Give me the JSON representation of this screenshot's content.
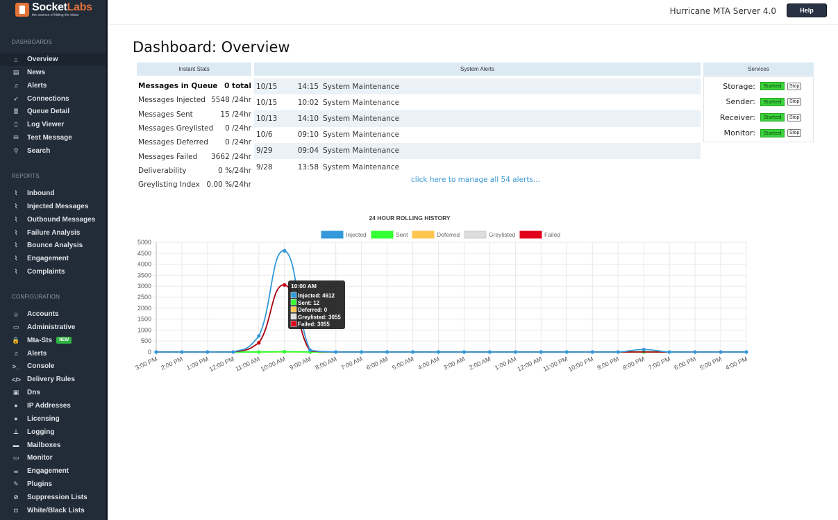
{
  "app": {
    "logo_name": "Socket",
    "logo_accent": "Labs",
    "logo_tagline": "the science of hitting the inbox",
    "server_name": "Hurricane MTA Server 4.0",
    "help_label": "Help"
  },
  "sidebar": {
    "sections": [
      {
        "label": "DASHBOARDS",
        "items": [
          {
            "label": "Overview",
            "icon": "home-icon",
            "glyph": "⌂",
            "active": true
          },
          {
            "label": "News",
            "icon": "newspaper-icon",
            "glyph": "▤"
          },
          {
            "label": "Alerts",
            "icon": "bell-icon",
            "glyph": "♫"
          },
          {
            "label": "Connections",
            "icon": "rocket-icon",
            "glyph": "➶"
          },
          {
            "label": "Queue Detail",
            "icon": "database-icon",
            "glyph": "≣"
          },
          {
            "label": "Log Viewer",
            "icon": "file-icon",
            "glyph": "▯"
          },
          {
            "label": "Test Message",
            "icon": "envelope-icon",
            "glyph": "✉"
          },
          {
            "label": "Search",
            "icon": "search-icon",
            "glyph": "⚲"
          }
        ]
      },
      {
        "label": "REPORTS",
        "items": [
          {
            "label": "Inbound",
            "icon": "line-chart-icon",
            "glyph": "⌇"
          },
          {
            "label": "Injected Messages",
            "icon": "line-chart-icon",
            "glyph": "⌇"
          },
          {
            "label": "Outbound Messages",
            "icon": "line-chart-icon",
            "glyph": "⌇"
          },
          {
            "label": "Failure Analysis",
            "icon": "line-chart-icon",
            "glyph": "⌇"
          },
          {
            "label": "Bounce Analysis",
            "icon": "line-chart-icon",
            "glyph": "⌇"
          },
          {
            "label": "Engagement",
            "icon": "line-chart-icon",
            "glyph": "⌇"
          },
          {
            "label": "Complaints",
            "icon": "line-chart-icon",
            "glyph": "⌇"
          }
        ]
      },
      {
        "label": "CONFIGURATION",
        "items": [
          {
            "label": "Accounts",
            "icon": "user-icon",
            "glyph": "☺"
          },
          {
            "label": "Administrative",
            "icon": "id-card-icon",
            "glyph": "▭"
          },
          {
            "label": "Mta-Sts",
            "icon": "lock-icon",
            "glyph": "🔒",
            "badge": "NEW"
          },
          {
            "label": "Alerts",
            "icon": "bell-icon",
            "glyph": "♫"
          },
          {
            "label": "Console",
            "icon": "terminal-icon",
            "glyph": ">_"
          },
          {
            "label": "Delivery Rules",
            "icon": "code-icon",
            "glyph": "</>"
          },
          {
            "label": "Dns",
            "icon": "address-book-icon",
            "glyph": "▣"
          },
          {
            "label": "IP Addresses",
            "icon": "globe-icon",
            "glyph": "●"
          },
          {
            "label": "Licensing",
            "icon": "certificate-icon",
            "glyph": "●"
          },
          {
            "label": "Logging",
            "icon": "stamp-icon",
            "glyph": "⊥"
          },
          {
            "label": "Mailboxes",
            "icon": "archive-icon",
            "glyph": "▬"
          },
          {
            "label": "Monitor",
            "icon": "desktop-icon",
            "glyph": "▭"
          },
          {
            "label": "Engagement",
            "icon": "link-icon",
            "glyph": "∞"
          },
          {
            "label": "Plugins",
            "icon": "plug-icon",
            "glyph": "✎"
          },
          {
            "label": "Suppression Lists",
            "icon": "ban-icon",
            "glyph": "⊘"
          },
          {
            "label": "White/Black Lists",
            "icon": "shield-icon",
            "glyph": "◘"
          }
        ]
      }
    ]
  },
  "page": {
    "title": "Dashboard: Overview"
  },
  "instant_stats": {
    "header": "Instant Stats",
    "rows": [
      {
        "label": "Messages in Queue",
        "value": "0 total",
        "bold": true
      },
      {
        "label": "Messages Injected",
        "value": "5548 /24hr"
      },
      {
        "label": "Messages Sent",
        "value": "15 /24hr"
      },
      {
        "label": "Messages Greylisted",
        "value": "0 /24hr"
      },
      {
        "label": "Messages Deferred",
        "value": "0 /24hr"
      },
      {
        "label": "Messages Failed",
        "value": "3662 /24hr"
      },
      {
        "label": "Deliverability",
        "value": "0 %/24hr"
      },
      {
        "label": "Greylisting Index",
        "value": "0.00 %/24hr"
      }
    ]
  },
  "system_alerts": {
    "header": "System Alerts",
    "rows": [
      {
        "date": "10/15",
        "time": "14:15",
        "message": "System Maintenance"
      },
      {
        "date": "10/15",
        "time": "10:02",
        "message": "System Maintenance"
      },
      {
        "date": "10/13",
        "time": "14:10",
        "message": "System Maintenance"
      },
      {
        "date": "10/6",
        "time": "09:10",
        "message": "System Maintenance"
      },
      {
        "date": "9/29",
        "time": "09:04",
        "message": "System Maintenance"
      },
      {
        "date": "9/28",
        "time": "13:58",
        "message": "System Maintenance"
      }
    ],
    "manage_link": "click here to manage all 54 alerts..."
  },
  "services": {
    "header": "Services",
    "rows": [
      {
        "name": "Storage:",
        "status": "Started",
        "action": "Stop"
      },
      {
        "name": "Sender:",
        "status": "Started",
        "action": "Stop"
      },
      {
        "name": "Receiver:",
        "status": "Started",
        "action": "Stop"
      },
      {
        "name": "Monitor:",
        "status": "Started",
        "action": "Stop"
      }
    ]
  },
  "chart_data": {
    "type": "line",
    "title": "24 HOUR ROLLING HISTORY",
    "xlabel": "",
    "ylabel": "",
    "ylim": [
      0,
      5000
    ],
    "yticks": [
      0,
      500,
      1000,
      1500,
      2000,
      2500,
      3000,
      3500,
      4000,
      4500,
      5000
    ],
    "grid": true,
    "legend_position": "top-center",
    "categories": [
      "3:00 PM",
      "2:00 PM",
      "1:00 PM",
      "12:00 PM",
      "11:00 AM",
      "10:00 AM",
      "9:00 AM",
      "8:00 AM",
      "7:00 AM",
      "6:00 AM",
      "5:00 AM",
      "4:00 AM",
      "3:00 AM",
      "2:00 AM",
      "1:00 AM",
      "12:00 AM",
      "11:00 PM",
      "10:00 PM",
      "9:00 PM",
      "8:00 PM",
      "7:00 PM",
      "6:00 PM",
      "5:00 PM",
      "4:00 PM"
    ],
    "series": [
      {
        "name": "Injected",
        "color": "#3498db",
        "values": [
          0,
          0,
          0,
          0,
          730,
          4612,
          80,
          0,
          0,
          0,
          0,
          0,
          0,
          0,
          0,
          0,
          0,
          0,
          0,
          110,
          0,
          0,
          0,
          0
        ]
      },
      {
        "name": "Sent",
        "color": "#33ff33",
        "values": [
          0,
          0,
          0,
          0,
          0,
          12,
          0,
          0,
          0,
          0,
          0,
          0,
          0,
          0,
          0,
          0,
          0,
          0,
          0,
          3,
          0,
          0,
          0,
          0
        ]
      },
      {
        "name": "Deferred",
        "color": "#ffc64f",
        "values": [
          0,
          0,
          0,
          0,
          0,
          0,
          0,
          0,
          0,
          0,
          0,
          0,
          0,
          0,
          0,
          0,
          0,
          0,
          0,
          0,
          0,
          0,
          0,
          0
        ]
      },
      {
        "name": "Greylisted",
        "color": "#dddddd",
        "values": [
          0,
          0,
          0,
          0,
          0,
          3055,
          0,
          0,
          0,
          0,
          0,
          0,
          0,
          0,
          0,
          0,
          0,
          0,
          0,
          0,
          0,
          0,
          0,
          0
        ]
      },
      {
        "name": "Failed",
        "color": "#e0001b",
        "values": [
          0,
          0,
          0,
          0,
          420,
          3055,
          50,
          0,
          0,
          0,
          0,
          0,
          0,
          0,
          0,
          0,
          0,
          0,
          0,
          0,
          0,
          0,
          0,
          0
        ]
      }
    ],
    "tooltip": {
      "title": "10:00 AM",
      "lines": [
        {
          "label": "Injected: 4612",
          "color": "#3498db"
        },
        {
          "label": "Sent: 12",
          "color": "#33ff33"
        },
        {
          "label": "Deferred: 0",
          "color": "#ffc64f"
        },
        {
          "label": "Greylisted: 3055",
          "color": "#dddddd"
        },
        {
          "label": "Failed: 3055",
          "color": "#e0001b"
        }
      ]
    }
  }
}
